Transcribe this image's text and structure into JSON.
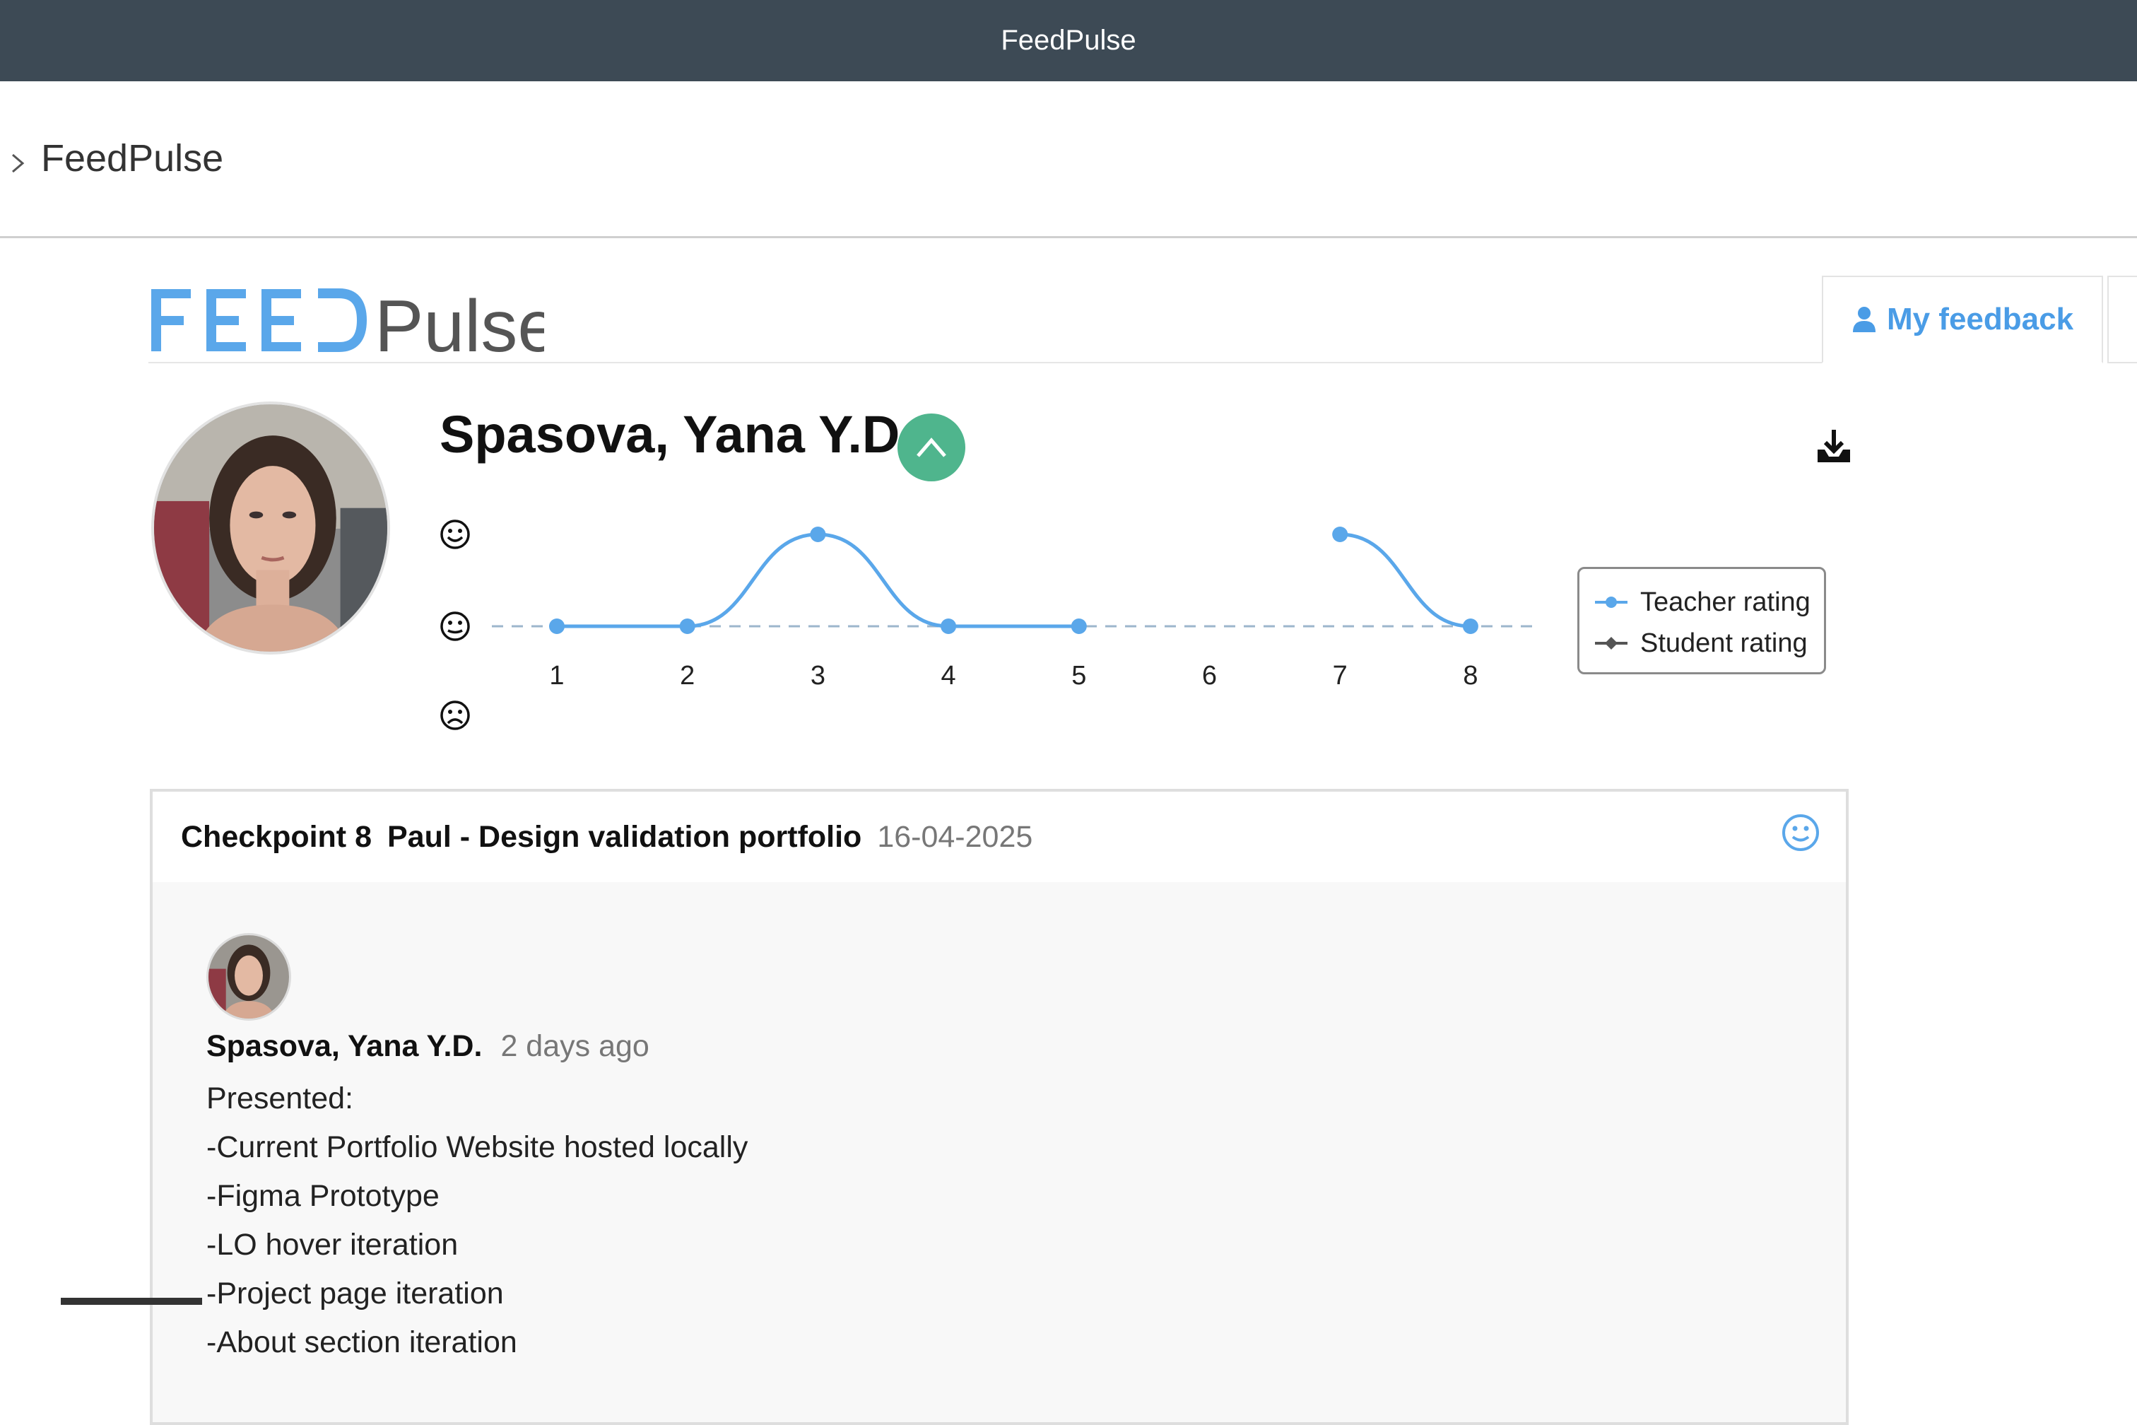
{
  "window": {
    "title": "FeedPulse"
  },
  "breadcrumb": {
    "label": "FeedPulse"
  },
  "logo": {
    "part1": "FEED",
    "part2": "Pulse"
  },
  "tabs": {
    "my_feedback": "My feedback"
  },
  "student": {
    "name": "Spasova, Yana Y.D."
  },
  "icons": {
    "chevron": "chevron-right-icon",
    "collapse": "chevron-up-icon",
    "download": "download-icon",
    "user": "user-icon",
    "happy": "smiley-happy-icon",
    "neutral": "smiley-neutral-icon",
    "sad": "smiley-sad-icon"
  },
  "colors": {
    "teacher": "#5aa7ea",
    "student": "#555555",
    "collapse_btn": "#4fb58d",
    "tab_accent": "#4a9ce6"
  },
  "chart_data": {
    "type": "line",
    "x": [
      1,
      2,
      3,
      4,
      5,
      6,
      7,
      8
    ],
    "y_levels": [
      "sad",
      "neutral",
      "happy"
    ],
    "series": [
      {
        "name": "Teacher rating",
        "values": [
          1,
          1,
          2,
          1,
          1,
          null,
          2,
          1
        ]
      },
      {
        "name": "Student rating",
        "values": []
      }
    ],
    "baseline": 1,
    "legend": "right"
  },
  "checkpoint": {
    "label": "Checkpoint 8",
    "title": "Paul - Design validation portfolio",
    "date": "16-04-2025"
  },
  "comment": {
    "author": "Spasova, Yana Y.D.",
    "time": "2 days ago",
    "lines": [
      "Presented:",
      "-Current Portfolio Website hosted locally",
      "-Figma Prototype",
      "-LO hover iteration",
      "-Project page iteration",
      "-About section iteration"
    ]
  }
}
